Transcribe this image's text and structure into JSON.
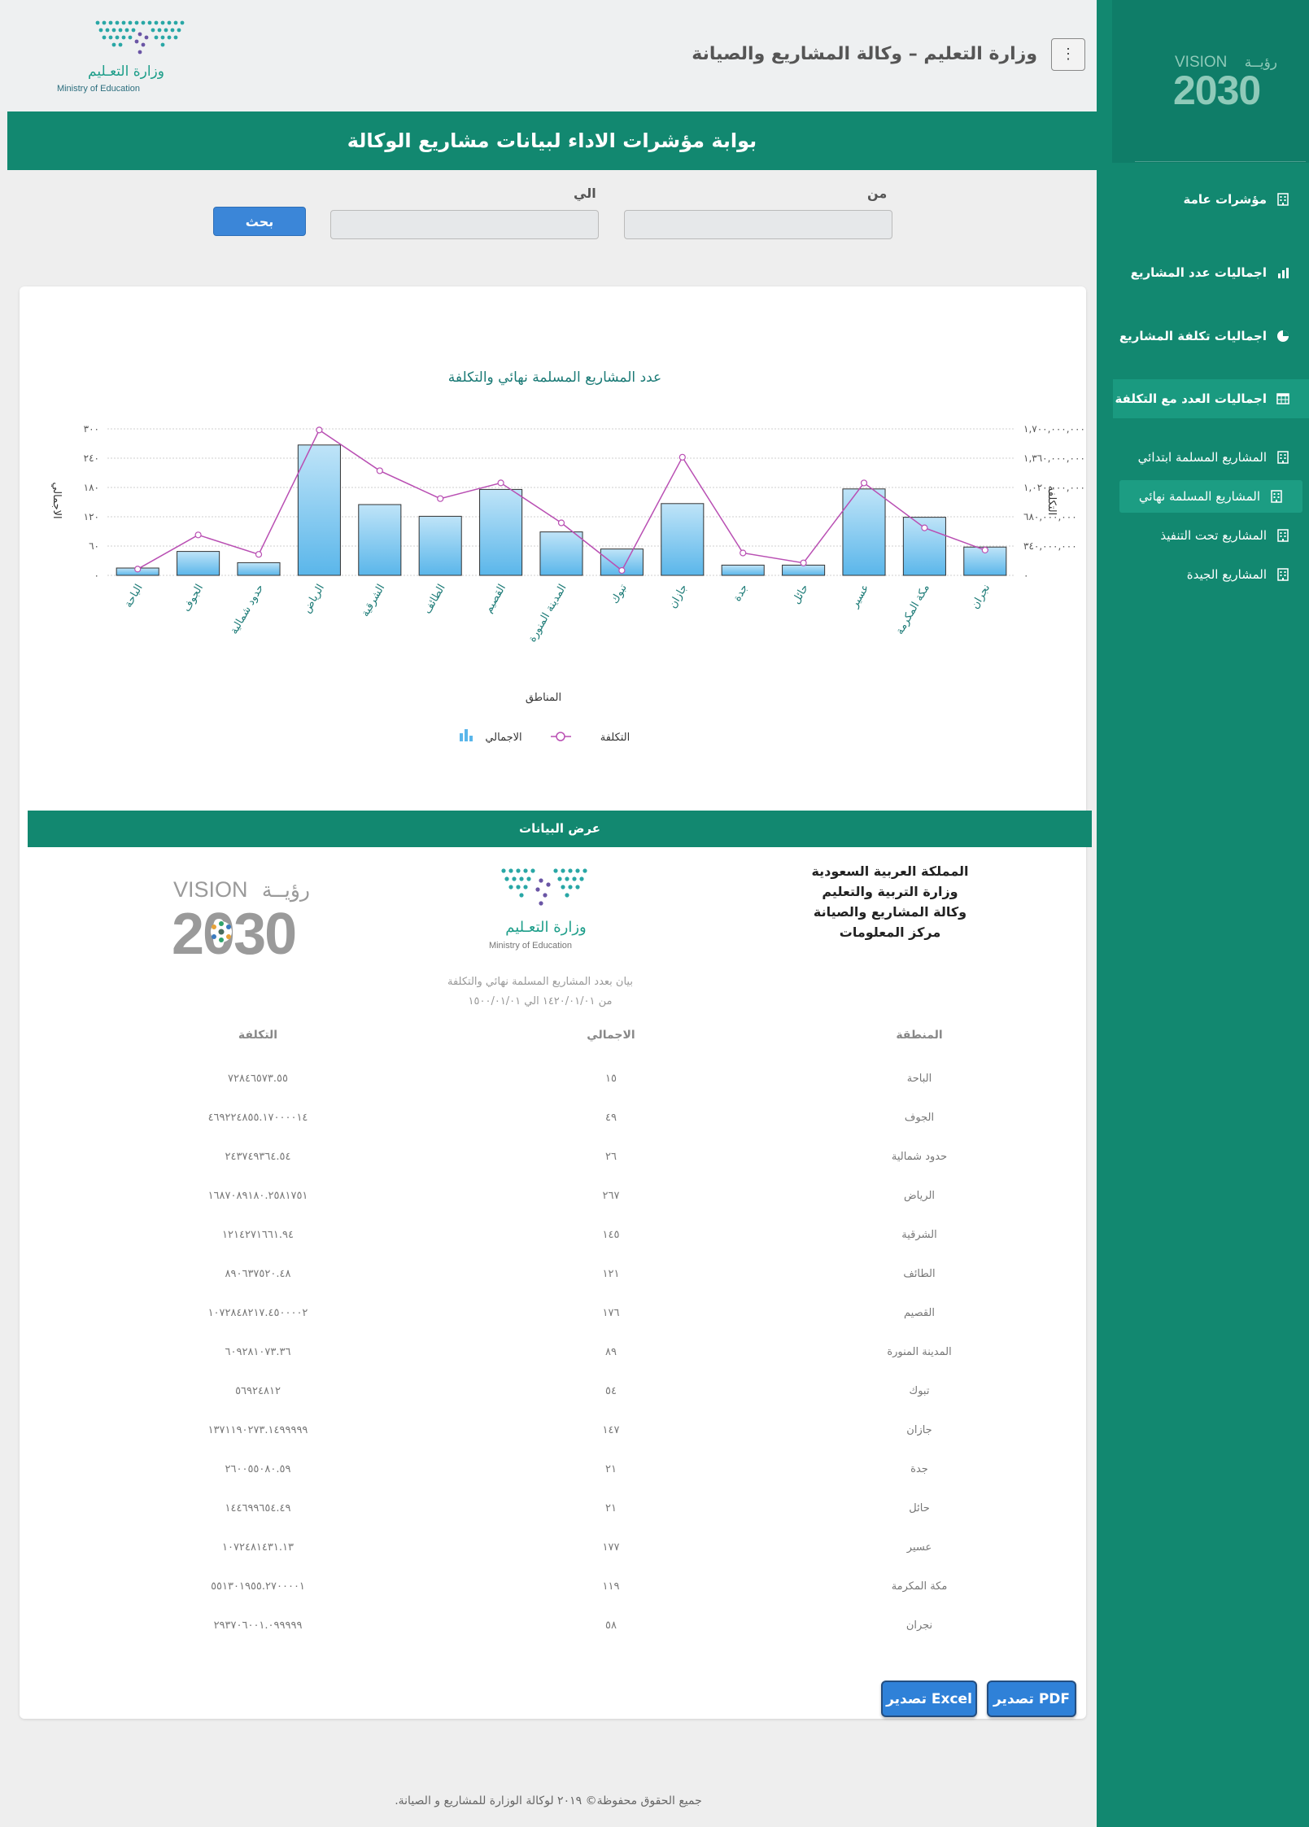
{
  "header": {
    "title": "وزارة التعليم – وكالة المشاريع والصيانة",
    "logo_ar": "وزارة التعـليم",
    "logo_en": "Ministry of Education"
  },
  "banner": {
    "title": "بوابة مؤشرات الاداء لبيانات مشاريع الوكالة"
  },
  "search": {
    "from_label": "من",
    "to_label": "الي",
    "from_value": "",
    "to_value": "",
    "button_label": "بحث"
  },
  "sidebar": {
    "vision_word": "VISION",
    "vision_ar": "رؤيــة",
    "vision_year": "2030",
    "items": [
      {
        "label": "مؤشرات عامة",
        "icon": "building-icon",
        "active": false
      },
      {
        "label": "اجماليات عدد المشاريع",
        "icon": "bar-chart-icon",
        "active": false
      },
      {
        "label": "اجماليات تكلفة المشاريع",
        "icon": "pie-chart-icon",
        "active": false
      },
      {
        "label": "اجماليات العدد مع التكلفة",
        "icon": "table-icon",
        "active": true
      }
    ],
    "sub_items": [
      {
        "label": "المشاريع المسلمة ابتدائي",
        "icon": "building-icon",
        "active": false
      },
      {
        "label": "المشاريع المسلمة نهائي",
        "icon": "building-icon",
        "active": true
      },
      {
        "label": "المشاريع تحت التنفيذ",
        "icon": "building-icon",
        "active": false
      },
      {
        "label": "المشاريع الجيدة",
        "icon": "building-icon",
        "active": false
      }
    ]
  },
  "colors": {
    "primary": "#128870",
    "bar_top": "#bfe4f8",
    "bar_bottom": "#5ab6ea",
    "line": "#b94fb3",
    "button": "#3b86d8"
  },
  "chart_data": {
    "type": "bar",
    "title": "عدد المشاريع المسلمة نهائي والتكلفة",
    "xlabel": "المناطق",
    "ylabel_left": "الاجمالي",
    "ylabel_right": "التكلفة",
    "y_ticks_left": [
      "٠",
      "٦٠",
      "١٢٠",
      "١٨٠",
      "٢٤٠",
      "٣٠٠"
    ],
    "y_ticks_right": [
      "٠",
      "٣٤٠,٠٠٠,٠٠٠",
      "٦٨٠,٠٠٠,٠٠٠",
      "١,٠٢٠,٠٠٠,٠٠٠",
      "١,٣٦٠,٠٠٠,٠٠٠",
      "١,٧٠٠,٠٠٠,٠٠٠"
    ],
    "ylim_left": [
      0,
      300
    ],
    "ylim_right": [
      0,
      1700000000
    ],
    "categories": [
      "الباحة",
      "الجوف",
      "حدود شمالية",
      "الرياض",
      "الشرقية",
      "الطائف",
      "القصيم",
      "المدينة المنورة",
      "تبوك",
      "جازان",
      "جدة",
      "حائل",
      "عسير",
      "مكة المكرمة",
      "نجران"
    ],
    "series": [
      {
        "name": "الاجمالي",
        "type": "bar",
        "axis": "left",
        "values": [
          15,
          49,
          26,
          267,
          145,
          121,
          176,
          89,
          54,
          147,
          21,
          21,
          177,
          119,
          58
        ]
      },
      {
        "name": "التكلفة",
        "type": "line",
        "axis": "right",
        "values": [
          72846573,
          469224855,
          243749364,
          1687089180,
          1214271661,
          890637520,
          1072848217,
          609281073,
          56924812,
          1371190273,
          260055080,
          144699654,
          1072481431,
          551301955,
          293706001
        ]
      }
    ],
    "legend": "bottom",
    "grid": true
  },
  "data_section": {
    "title": "عرض البيانات",
    "org_lines": [
      "المملكة العربية السعودية",
      "وزارة التربية والتعليم",
      "وكالة المشاريع والصيانة",
      "مركز المعلومات"
    ],
    "subtitle": "بيان بعدد المشاريع المسلمة نهائي والتكلفة",
    "date_range": "من ١٤٢٠/٠١/٠١ الي ١٥٠٠/٠١/٠١",
    "columns": [
      "المنطقة",
      "الاجمالي",
      "التكلفة"
    ],
    "rows": [
      [
        "الباحة",
        "١٥",
        "٧٢٨٤٦٥٧٣.٥٥"
      ],
      [
        "الجوف",
        "٤٩",
        "٤٦٩٢٢٤٨٥٥.١٧٠٠٠٠١٤"
      ],
      [
        "حدود شمالية",
        "٢٦",
        "٢٤٣٧٤٩٣٦٤.٥٤"
      ],
      [
        "الرياض",
        "٢٦٧",
        "١٦٨٧٠٨٩١٨٠.٢٥٨١٧٥١"
      ],
      [
        "الشرقية",
        "١٤٥",
        "١٢١٤٢٧١٦٦١.٩٤"
      ],
      [
        "الطائف",
        "١٢١",
        "٨٩٠٦٣٧٥٢٠.٤٨"
      ],
      [
        "القصيم",
        "١٧٦",
        "١٠٧٢٨٤٨٢١٧.٤٥٠٠٠٠٢"
      ],
      [
        "المدينة المنورة",
        "٨٩",
        "٦٠٩٢٨١٠٧٣.٣٦"
      ],
      [
        "تبوك",
        "٥٤",
        "٥٦٩٢٤٨١٢"
      ],
      [
        "جازان",
        "١٤٧",
        "١٣٧١١٩٠٢٧٣.١٤٩٩٩٩٩"
      ],
      [
        "جدة",
        "٢١",
        "٢٦٠٠٥٥٠٨٠.٥٩"
      ],
      [
        "حائل",
        "٢١",
        "١٤٤٦٩٩٦٥٤.٤٩"
      ],
      [
        "عسير",
        "١٧٧",
        "١٠٧٢٤٨١٤٣١.١٣"
      ],
      [
        "مكة المكرمة",
        "١١٩",
        "٥٥١٣٠١٩٥٥.٢٧٠٠٠٠١"
      ],
      [
        "نجران",
        "٥٨",
        "٢٩٣٧٠٦٠٠١.٠٩٩٩٩٩"
      ]
    ]
  },
  "export": {
    "pdf_label": "تصدير PDF",
    "excel_label": "تصدير Excel"
  },
  "footer": {
    "text": "جميع الحقوق محفوظة© ٢٠١٩ لوكالة الوزارة للمشاريع و الصيانة."
  }
}
